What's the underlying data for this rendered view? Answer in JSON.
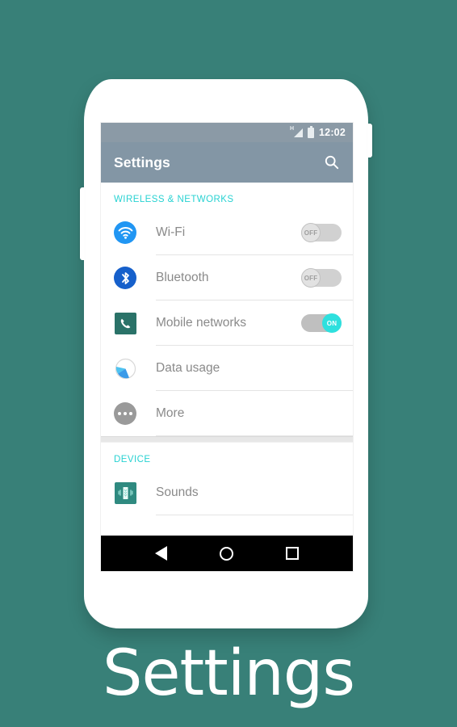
{
  "page": {
    "background_color": "#388078",
    "caption": "Settings"
  },
  "phone": {
    "volume_button_name": "volume-rocker",
    "power_button_name": "power-button"
  },
  "status_bar": {
    "signal_label": "H",
    "signal_icon": "signal-triangle-icon",
    "battery_icon": "battery-icon",
    "time": "12:02",
    "background_color": "#8b9aa6"
  },
  "app_bar": {
    "title": "Settings",
    "search_icon": "search-icon",
    "background_color": "#8396a5"
  },
  "sections": [
    {
      "header": "WIRELESS & NETWORKS",
      "header_color": "#28d2d2",
      "rows": [
        {
          "label": "Wi-Fi",
          "icon": "wifi-icon",
          "icon_color": "#2196f3",
          "control": "toggle",
          "toggle_state": "OFF"
        },
        {
          "label": "Bluetooth",
          "icon": "bluetooth-icon",
          "icon_color": "#1660cb",
          "control": "toggle",
          "toggle_state": "OFF"
        },
        {
          "label": "Mobile networks",
          "icon": "phone-handset-icon",
          "icon_color": "#2a7268",
          "control": "toggle",
          "toggle_state": "ON"
        },
        {
          "label": "Data usage",
          "icon": "pie-chart-icon",
          "icon_color": "#3b9ae8",
          "control": "none",
          "toggle_state": ""
        },
        {
          "label": "More",
          "icon": "more-dots-icon",
          "icon_color": "#9a9a9a",
          "control": "none",
          "toggle_state": ""
        }
      ]
    },
    {
      "header": "DEVICE",
      "header_color": "#28d2d2",
      "rows": [
        {
          "label": "Sounds",
          "icon": "vibrating-phone-icon",
          "icon_color": "#2f8a80",
          "control": "none",
          "toggle_state": ""
        }
      ]
    }
  ],
  "nav_bar": {
    "back_icon": "back-triangle-icon",
    "home_icon": "home-circle-icon",
    "recents_icon": "recents-square-icon",
    "background_color": "#000000"
  }
}
